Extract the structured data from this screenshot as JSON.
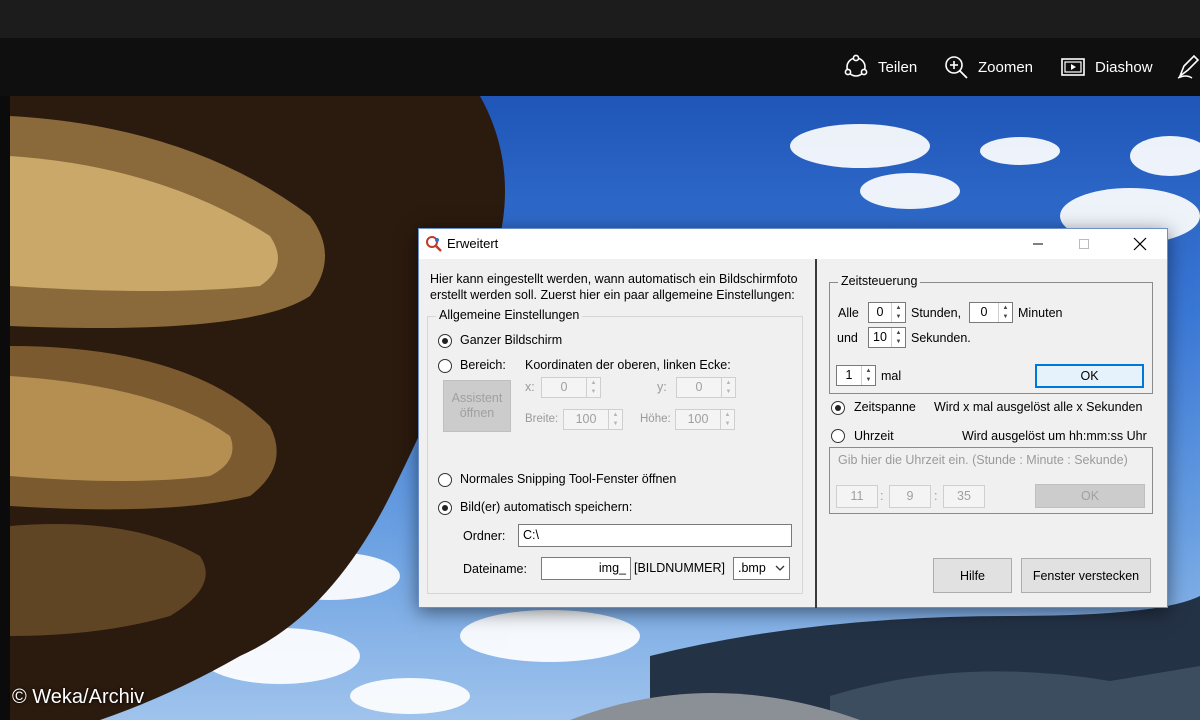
{
  "viewer": {
    "toolbar": {
      "share_label": "Teilen",
      "zoom_label": "Zoomen",
      "slideshow_label": "Diashow"
    },
    "copyright": "© Weka/Archiv"
  },
  "dialog": {
    "title": "Erweitert",
    "left": {
      "intro_line1": "Hier kann eingestellt werden, wann automatisch ein Bildschirmfoto",
      "intro_line2": "erstellt werden soll. Zuerst hier ein paar allgemeine Einstellungen:",
      "group_title": "Allgemeine Einstellungen",
      "fullscreen_label": "Ganzer Bildschirm",
      "area_label": "Bereich:",
      "coords_label": "Koordinaten der oberen, linken Ecke:",
      "assistant_label_line1": "Assistent",
      "assistant_label_line2": "öffnen",
      "x_label": "x:",
      "x_value": "0",
      "y_label": "y:",
      "y_value": "0",
      "width_label": "Breite:",
      "width_value": "100",
      "height_label": "Höhe:",
      "height_value": "100",
      "snipping_label": "Normales Snipping Tool-Fenster öffnen",
      "autosave_label": "Bild(er) automatisch speichern:",
      "folder_label": "Ordner:",
      "folder_value": "C:\\",
      "filename_label": "Dateiname:",
      "filename_value": "img_",
      "filename_suffix": "[BILDNUMMER]",
      "extension_value": ".bmp"
    },
    "right": {
      "group_title": "Zeitsteuerung",
      "every_label": "Alle",
      "hours_value": "0",
      "hours_label": "Stunden,",
      "minutes_value": "0",
      "minutes_label": "Minuten",
      "and_label": "und",
      "seconds_value": "10",
      "seconds_label": "Sekunden.",
      "times_value": "1",
      "times_label": "mal",
      "ok_label": "OK",
      "timespan_label": "Zeitspanne",
      "timespan_desc": "Wird x mal ausgelöst alle x Sekunden",
      "clock_label": "Uhrzeit",
      "clock_desc": "Wird ausgelöst um hh:mm:ss Uhr",
      "clock_placeholder": "Gib hier die Uhrzeit ein. (Stunde : Minute : Sekunde)",
      "clock_hour": "11",
      "clock_minute": "9",
      "clock_second": "35",
      "clock_separator": ":",
      "clock_ok_label": "OK",
      "help_label": "Hilfe",
      "hide_label": "Fenster verstecken"
    }
  }
}
